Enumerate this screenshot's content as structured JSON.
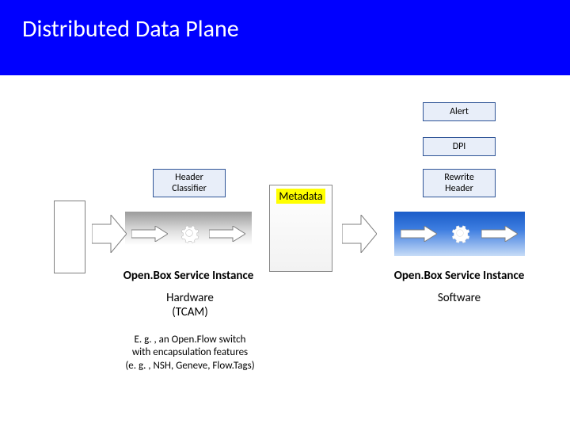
{
  "title": "Distributed Data Plane",
  "blocks": {
    "alert": "Alert",
    "dpi": "DPI",
    "header_classifier": "Header\nClassifier",
    "rewrite_header": "Rewrite\nHeader"
  },
  "metadata_label": "Metadata",
  "left": {
    "caption": "Open.Box Service Instance",
    "type": "Hardware\n(TCAM)",
    "note": "E. g. , an Open.Flow switch\nwith encapsulation features\n(e. g. , NSH, Geneve, Flow.Tags)"
  },
  "right": {
    "caption": "Open.Box Service Instance",
    "type": "Software"
  }
}
